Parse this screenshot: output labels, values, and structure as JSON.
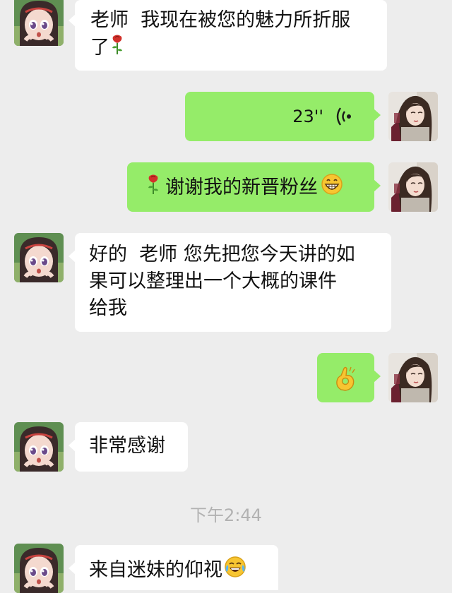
{
  "messages": [
    {
      "lines": [
        "老师  我现在被您的魅力所折服",
        "了"
      ]
    },
    {
      "duration": "23''"
    },
    {
      "text": "谢谢我的新晋粉丝"
    },
    {
      "lines": [
        "好的  老师 您先把您今天讲的如",
        "果可以整理出一个大概的课件",
        "给我"
      ]
    },
    {
      "emoji": "ok-hand"
    },
    {
      "text": "非常感谢"
    },
    {
      "text": "来自迷妹的仰视"
    }
  ],
  "timestamp": "下午2:44",
  "icons": {
    "rose": "rose-icon",
    "grin": "grinning-emoji",
    "laugh": "tears-of-joy-emoji",
    "voice": "voice-wave-icon",
    "ok": "ok-hand-emoji"
  },
  "colors": {
    "background": "#ededed",
    "incoming_bubble": "#ffffff",
    "outgoing_bubble": "#95ec69",
    "timestamp": "#b2b2b2"
  }
}
